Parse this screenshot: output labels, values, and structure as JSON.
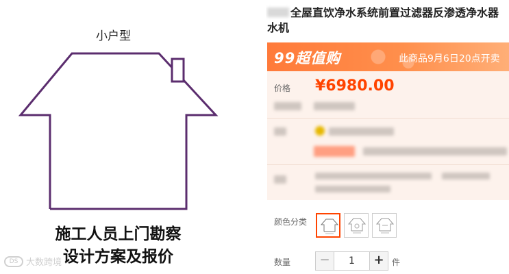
{
  "illustration": {
    "label": "小户型",
    "caption_line1": "施工人员上门勘察",
    "caption_line2": "设计方案及报价",
    "watermark": "大数跨境",
    "watermark_logo": "DS",
    "stroke_color": "#5b2d6e"
  },
  "product": {
    "title": "全屋直饮净水系统前置过滤器反渗透净水器 水机",
    "promo": {
      "logo": "99超值购",
      "text": "此商品9月6日20点开卖",
      "color": "#ff7a3a"
    },
    "price_label": "价格",
    "price": "¥6980.00",
    "price_color": "#ff4400",
    "color_label": "颜色分类",
    "quantity_label": "数量",
    "quantity": "1",
    "minus": "−",
    "plus": "+",
    "unit": "件"
  }
}
